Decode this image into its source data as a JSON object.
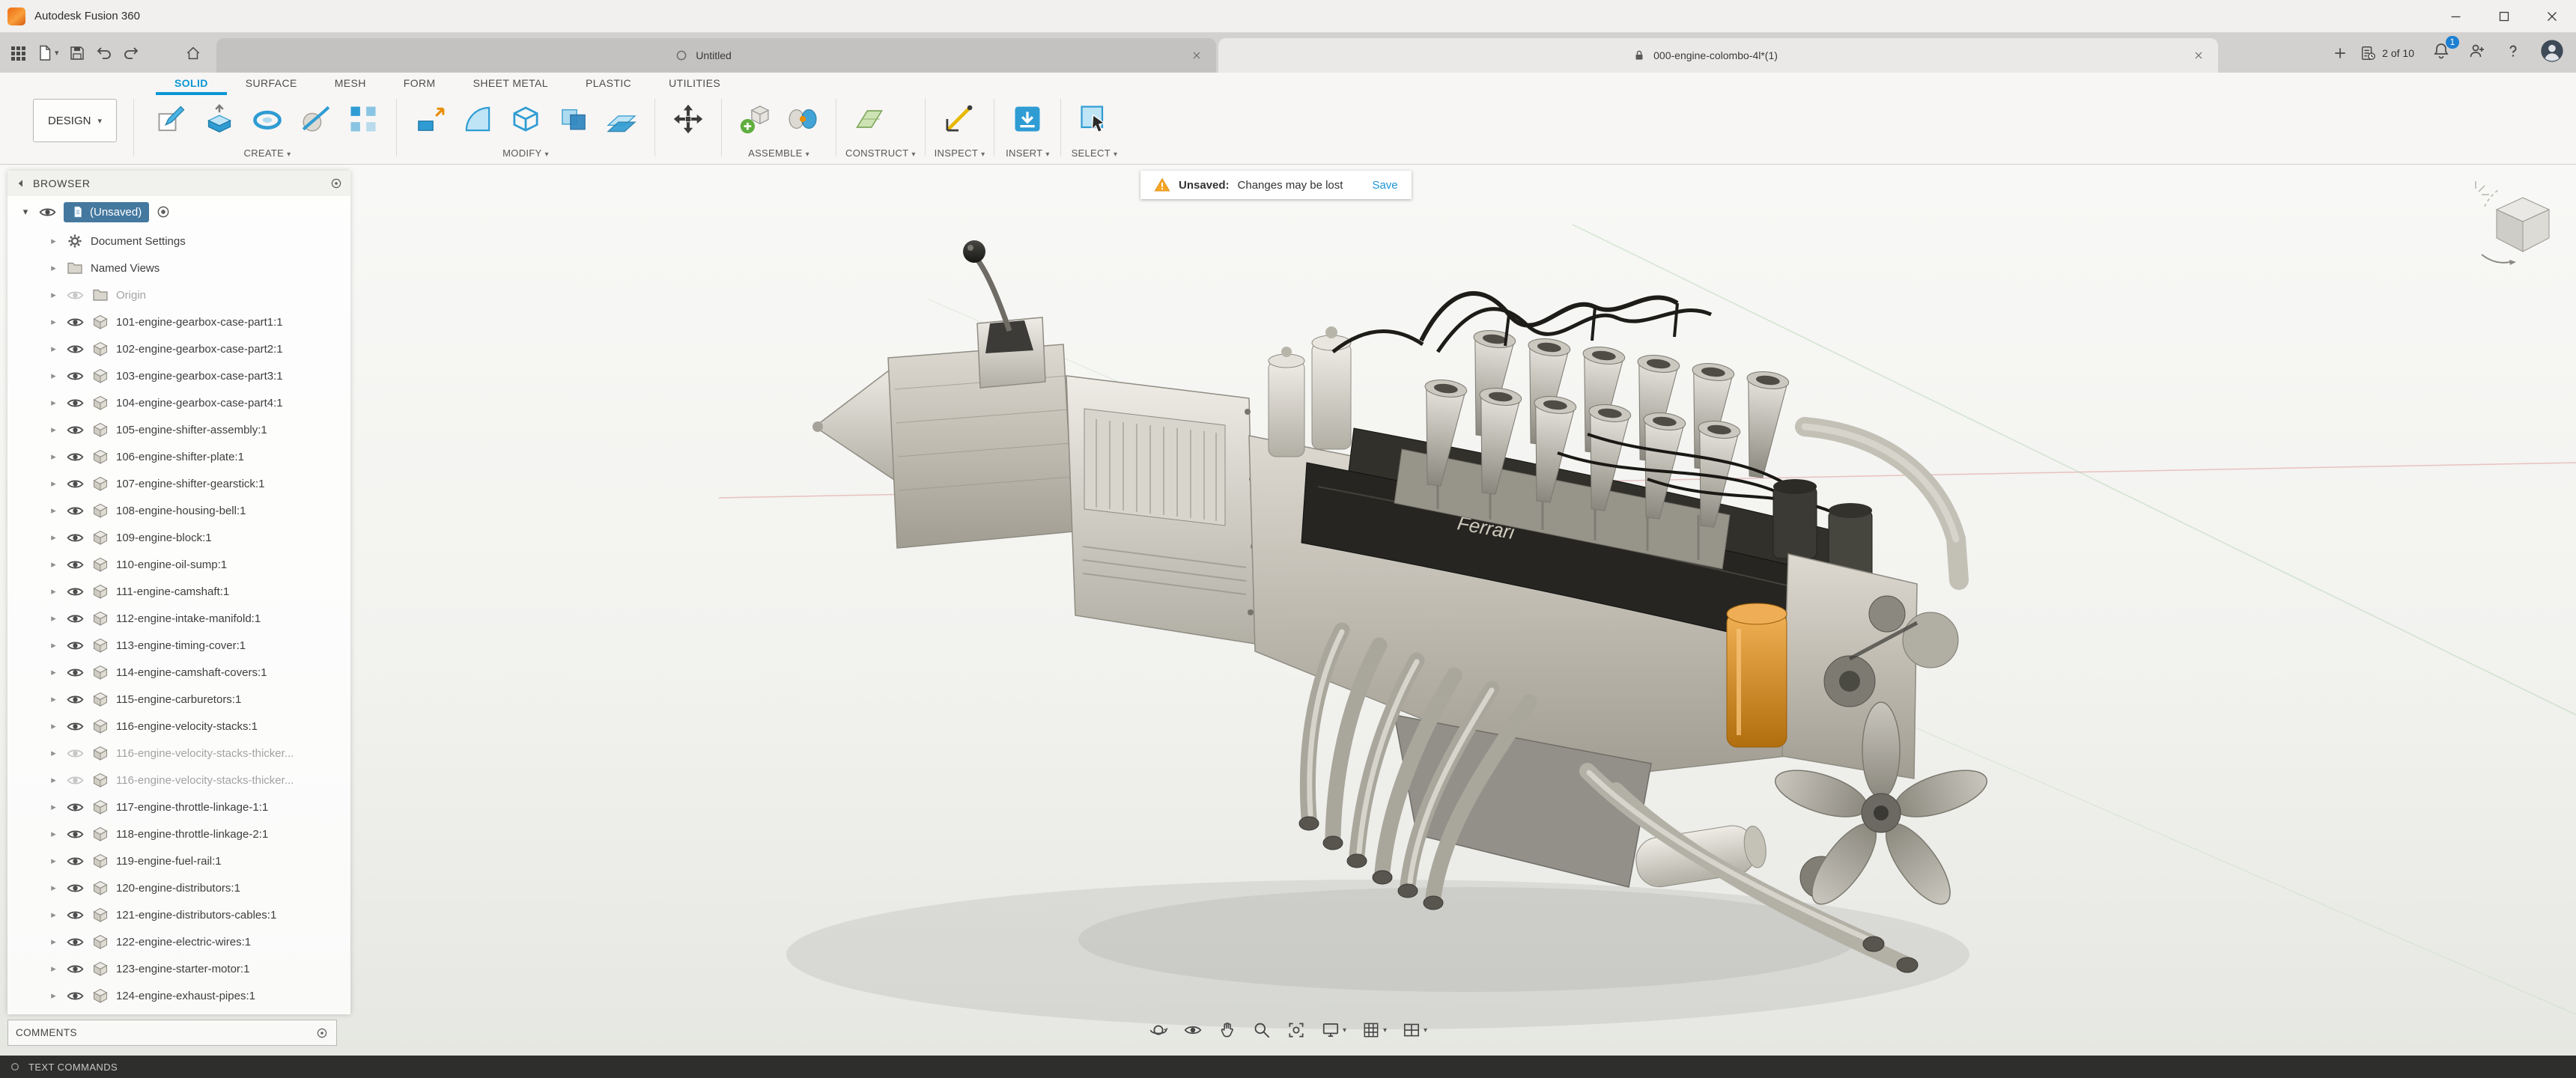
{
  "titlebar": {
    "app_title": "Autodesk Fusion 360",
    "window_controls": [
      "minimize",
      "maximize",
      "close-window"
    ]
  },
  "tabbar": {
    "left_tools": [
      "data-panel",
      "file-menu",
      "save",
      "undo",
      "redo"
    ],
    "documents": [
      {
        "label": "Untitled"
      },
      {
        "label": "000-engine-colombo-4l*(1)"
      }
    ],
    "job_progress": "2 of 10",
    "notification_badge": "1"
  },
  "ribbon": {
    "design_menu_label": "DESIGN",
    "active_tab": "SOLID",
    "tabs": [
      "SOLID",
      "SURFACE",
      "MESH",
      "FORM",
      "SHEET METAL",
      "PLASTIC",
      "UTILITIES"
    ],
    "groups": [
      {
        "label": "CREATE",
        "icons": [
          "create-sketch",
          "extrude",
          "revolve",
          "sweep",
          "rectangular-pattern"
        ]
      },
      {
        "label": "MODIFY",
        "icons": [
          "press-pull",
          "fillet",
          "shell",
          "combine",
          "offset-face"
        ]
      },
      {
        "label": "",
        "icons": [
          "move-copy"
        ]
      },
      {
        "label": "ASSEMBLE",
        "icons": [
          "new-component",
          "joint"
        ]
      },
      {
        "label": "CONSTRUCT",
        "icons": [
          "construction-plane"
        ]
      },
      {
        "label": "INSPECT",
        "icons": [
          "measure"
        ]
      },
      {
        "label": "INSERT",
        "icons": [
          "insert"
        ]
      },
      {
        "label": "SELECT",
        "icons": [
          "select"
        ]
      }
    ]
  },
  "unsaved_bar": {
    "title": "Unsaved:",
    "message": "Changes may be lost",
    "action_label": "Save"
  },
  "browser": {
    "header": "BROWSER",
    "root_label": "(Unsaved)",
    "comments_header": "COMMENTS",
    "items": [
      {
        "label": "Document Settings",
        "icon": "gear",
        "eye": "none"
      },
      {
        "label": "Named Views",
        "icon": "folder",
        "eye": "none"
      },
      {
        "label": "Origin",
        "icon": "folder",
        "eye": "hidden"
      },
      {
        "label": "101-engine-gearbox-case-part1:1",
        "icon": "component",
        "eye": "visible"
      },
      {
        "label": "102-engine-gearbox-case-part2:1",
        "icon": "component",
        "eye": "visible"
      },
      {
        "label": "103-engine-gearbox-case-part3:1",
        "icon": "component",
        "eye": "visible"
      },
      {
        "label": "104-engine-gearbox-case-part4:1",
        "icon": "component",
        "eye": "visible"
      },
      {
        "label": "105-engine-shifter-assembly:1",
        "icon": "component",
        "eye": "visible"
      },
      {
        "label": "106-engine-shifter-plate:1",
        "icon": "component",
        "eye": "visible"
      },
      {
        "label": "107-engine-shifter-gearstick:1",
        "icon": "component",
        "eye": "visible"
      },
      {
        "label": "108-engine-housing-bell:1",
        "icon": "component",
        "eye": "visible"
      },
      {
        "label": "109-engine-block:1",
        "icon": "component",
        "eye": "visible"
      },
      {
        "label": "110-engine-oil-sump:1",
        "icon": "component",
        "eye": "visible"
      },
      {
        "label": "111-engine-camshaft:1",
        "icon": "component",
        "eye": "visible"
      },
      {
        "label": "112-engine-intake-manifold:1",
        "icon": "component",
        "eye": "visible"
      },
      {
        "label": "113-engine-timing-cover:1",
        "icon": "component",
        "eye": "visible"
      },
      {
        "label": "114-engine-camshaft-covers:1",
        "icon": "component",
        "eye": "visible"
      },
      {
        "label": "115-engine-carburetors:1",
        "icon": "component",
        "eye": "visible"
      },
      {
        "label": "116-engine-velocity-stacks:1",
        "icon": "component",
        "eye": "visible"
      },
      {
        "label": "116-engine-velocity-stacks-thicker...",
        "icon": "component",
        "eye": "hidden"
      },
      {
        "label": "116-engine-velocity-stacks-thicker...",
        "icon": "component",
        "eye": "hidden"
      },
      {
        "label": "117-engine-throttle-linkage-1:1",
        "icon": "component",
        "eye": "visible"
      },
      {
        "label": "118-engine-throttle-linkage-2:1",
        "icon": "component",
        "eye": "visible"
      },
      {
        "label": "119-engine-fuel-rail:1",
        "icon": "component",
        "eye": "visible"
      },
      {
        "label": "120-engine-distributors:1",
        "icon": "component",
        "eye": "visible"
      },
      {
        "label": "121-engine-distributors-cables:1",
        "icon": "component",
        "eye": "visible"
      },
      {
        "label": "122-engine-electric-wires:1",
        "icon": "component",
        "eye": "visible"
      },
      {
        "label": "123-engine-starter-motor:1",
        "icon": "component",
        "eye": "visible"
      },
      {
        "label": "124-engine-exhaust-pipes:1",
        "icon": "component",
        "eye": "visible"
      }
    ]
  },
  "view_navbar": {
    "icons": [
      {
        "name": "orbit",
        "caret": false
      },
      {
        "name": "look-at",
        "caret": false
      },
      {
        "name": "pan",
        "caret": false
      },
      {
        "name": "zoom",
        "caret": false
      },
      {
        "name": "fit",
        "caret": false
      },
      {
        "name": "display-settings",
        "caret": true
      },
      {
        "name": "grid-settings",
        "caret": true
      },
      {
        "name": "viewports",
        "caret": true
      }
    ]
  },
  "viewport": {
    "engine_badge": "Ferrari"
  },
  "statusbar": {
    "label": "TEXT COMMANDS"
  }
}
